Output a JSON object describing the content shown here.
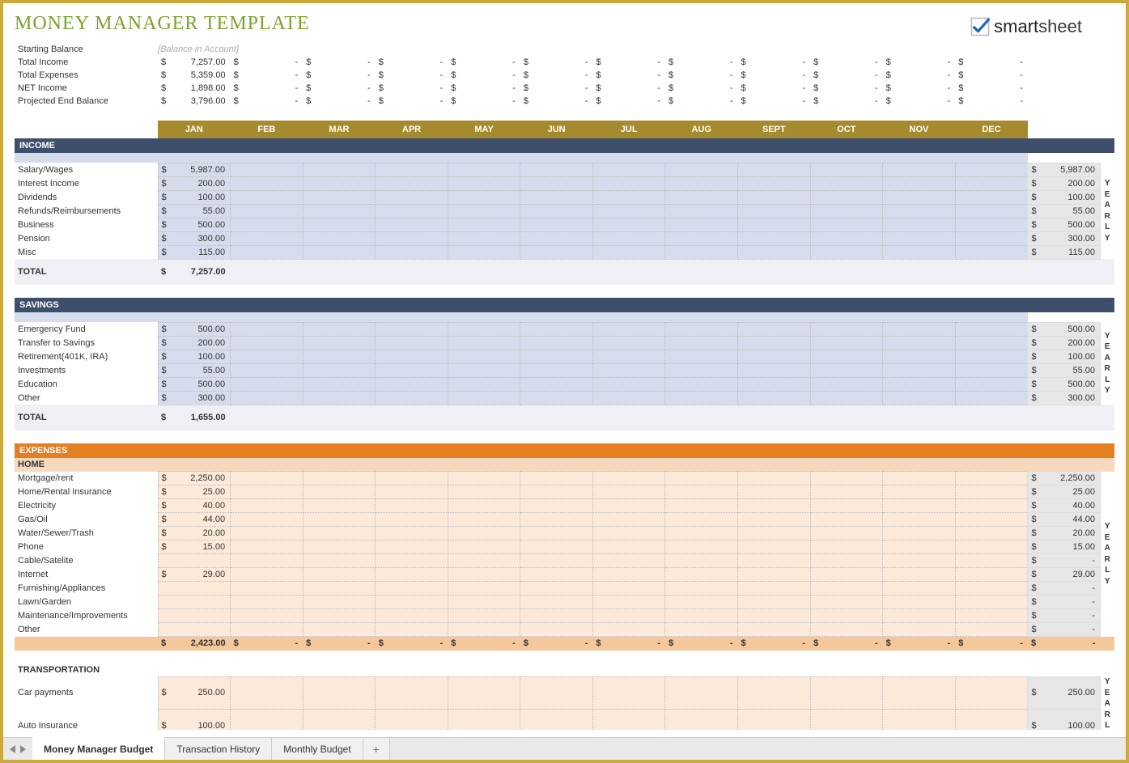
{
  "title": "MONEY MANAGER TEMPLATE",
  "brand": {
    "name_part1": "smart",
    "name_part2": "sheet"
  },
  "months": [
    "JAN",
    "FEB",
    "MAR",
    "APR",
    "MAY",
    "JUN",
    "JUL",
    "AUG",
    "SEPT",
    "OCT",
    "NOV",
    "DEC"
  ],
  "yearly_label": "YEARLY",
  "summary": {
    "starting_balance": {
      "label": "Starting Balance",
      "placeholder": "[Balance in Account]"
    },
    "total_income": {
      "label": "Total Income",
      "jan": "7,257.00"
    },
    "total_expenses": {
      "label": "Total Expenses",
      "jan": "5,359.00"
    },
    "net_income": {
      "label": "NET Income",
      "jan": "1,898.00"
    },
    "projected_end": {
      "label": "Projected End Balance",
      "jan": "3,796.00"
    }
  },
  "sections": {
    "income": {
      "title": "INCOME",
      "rows": [
        {
          "label": "Salary/Wages",
          "jan": "5,987.00",
          "yearly": "5,987.00"
        },
        {
          "label": "Interest Income",
          "jan": "200.00",
          "yearly": "200.00"
        },
        {
          "label": "Dividends",
          "jan": "100.00",
          "yearly": "100.00"
        },
        {
          "label": "Refunds/Reimbursements",
          "jan": "55.00",
          "yearly": "55.00"
        },
        {
          "label": "Business",
          "jan": "500.00",
          "yearly": "500.00"
        },
        {
          "label": "Pension",
          "jan": "300.00",
          "yearly": "300.00"
        },
        {
          "label": "Misc",
          "jan": "115.00",
          "yearly": "115.00"
        }
      ],
      "total": {
        "label": "TOTAL",
        "jan": "7,257.00"
      }
    },
    "savings": {
      "title": "SAVINGS",
      "rows": [
        {
          "label": "Emergency Fund",
          "jan": "500.00",
          "yearly": "500.00"
        },
        {
          "label": "Transfer to Savings",
          "jan": "200.00",
          "yearly": "200.00"
        },
        {
          "label": "Retirement(401K, IRA)",
          "jan": "100.00",
          "yearly": "100.00"
        },
        {
          "label": "Investments",
          "jan": "55.00",
          "yearly": "55.00"
        },
        {
          "label": "Education",
          "jan": "500.00",
          "yearly": "500.00"
        },
        {
          "label": "Other",
          "jan": "300.00",
          "yearly": "300.00"
        }
      ],
      "total": {
        "label": "TOTAL",
        "jan": "1,655.00"
      }
    },
    "expenses": {
      "title": "EXPENSES"
    },
    "home": {
      "title": "HOME",
      "rows": [
        {
          "label": "Mortgage/rent",
          "jan": "2,250.00",
          "yearly": "2,250.00"
        },
        {
          "label": "Home/Rental Insurance",
          "jan": "25.00",
          "yearly": "25.00"
        },
        {
          "label": "Electricity",
          "jan": "40.00",
          "yearly": "40.00"
        },
        {
          "label": "Gas/Oil",
          "jan": "44.00",
          "yearly": "44.00"
        },
        {
          "label": "Water/Sewer/Trash",
          "jan": "20.00",
          "yearly": "20.00"
        },
        {
          "label": "Phone",
          "jan": "15.00",
          "yearly": "15.00"
        },
        {
          "label": "Cable/Satelite",
          "jan": "",
          "yearly": "-"
        },
        {
          "label": "Internet",
          "jan": "29.00",
          "yearly": "29.00"
        },
        {
          "label": "Furnishing/Appliances",
          "jan": "",
          "yearly": "-"
        },
        {
          "label": "Lawn/Garden",
          "jan": "",
          "yearly": "-"
        },
        {
          "label": "Maintenance/Improvements",
          "jan": "",
          "yearly": "-"
        },
        {
          "label": "Other",
          "jan": "",
          "yearly": "-"
        }
      ],
      "subtotal": {
        "jan": "2,423.00"
      }
    },
    "transportation": {
      "title": "TRANSPORTATION",
      "rows": [
        {
          "label": "Car payments",
          "jan": "250.00",
          "yearly": "250.00"
        },
        {
          "label": "Auto Insurance",
          "jan": "100.00",
          "yearly": "100.00"
        }
      ]
    }
  },
  "tabs": {
    "active": "Money Manager Budget",
    "items": [
      "Money Manager Budget",
      "Transaction History",
      "Monthly Budget"
    ],
    "add": "+"
  }
}
